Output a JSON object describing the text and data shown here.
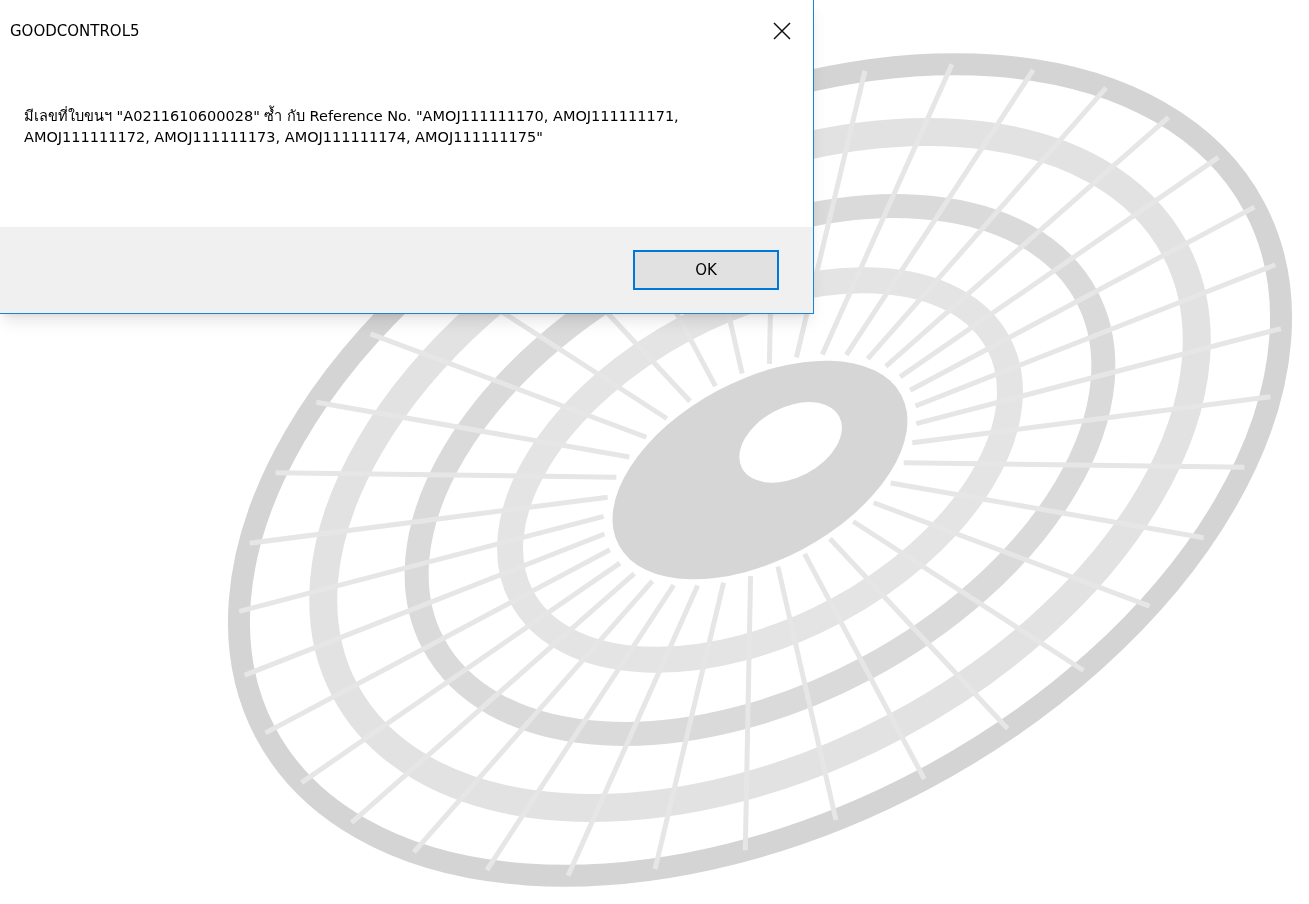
{
  "dialog": {
    "title": "GOODCONTROL5",
    "message": "มีเลขที่ใบขนฯ \"A0211610600028\" ซ้ำ กับ Reference No. \"AMOJ111111170, AMOJ111111171, AMOJ111111172, AMOJ111111173, AMOJ111111174, AMOJ111111175\"",
    "buttons": [
      {
        "label": "OK",
        "selected": true
      }
    ]
  }
}
